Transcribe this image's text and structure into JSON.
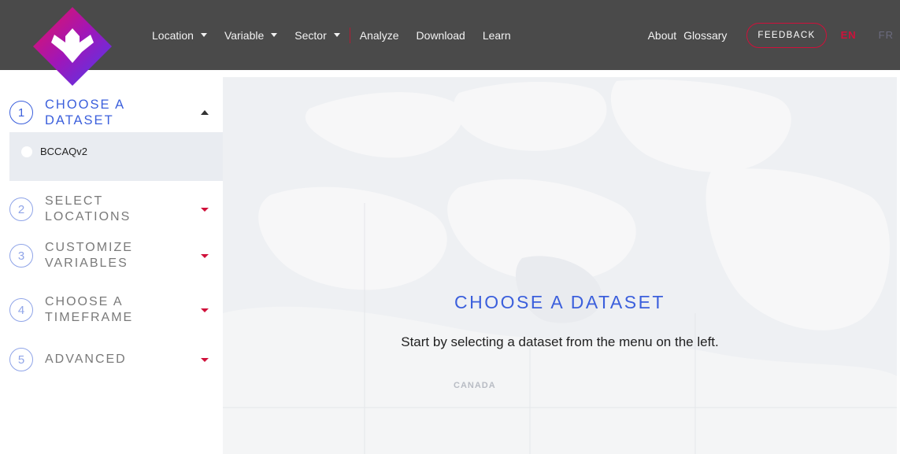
{
  "nav": {
    "location": "Location",
    "variable": "Variable",
    "sector": "Sector",
    "analyze": "Analyze",
    "download": "Download",
    "learn": "Learn",
    "about": "About",
    "glossary": "Glossary",
    "feedback": "FEEDBACK",
    "lang_en": "EN",
    "lang_fr": "FR"
  },
  "steps": [
    {
      "num": "1",
      "label": "CHOOSE A DATASET",
      "active": true
    },
    {
      "num": "2",
      "label": "SELECT LOCATIONS"
    },
    {
      "num": "3",
      "label": "CUSTOMIZE VARIABLES"
    },
    {
      "num": "4",
      "label": "CHOOSE A TIMEFRAME"
    },
    {
      "num": "5",
      "label": "ADVANCED"
    }
  ],
  "datasets": [
    {
      "label": "BCCAQv2",
      "selected": false
    }
  ],
  "main": {
    "title": "CHOOSE A DATASET",
    "description": "Start by selecting a dataset from the menu on the left.",
    "map_label": "CANADA"
  },
  "colors": {
    "header_bg": "#4a4a4a",
    "accent_blue": "#3b5fdc",
    "accent_red": "#d0103a",
    "map_bg": "#eef0f3",
    "panel_bg": "#e9ecf1"
  },
  "icons": {
    "logo": "maple-arrow-diamond-logo",
    "nav_caret": "caret-down-icon",
    "step_caret_open": "caret-up-icon",
    "step_caret_closed": "caret-down-icon"
  }
}
